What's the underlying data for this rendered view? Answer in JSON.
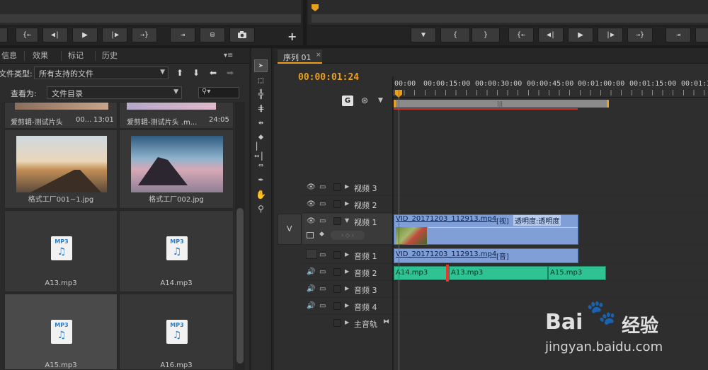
{
  "source_monitor": {
    "buttons": [
      "{←",
      "◀|",
      "▶",
      "|▶",
      "→}",
      "⇥",
      "⊟",
      "camera"
    ],
    "add": "+"
  },
  "program_monitor": {
    "buttons": [
      "▼",
      "{",
      "}",
      "{←",
      "◀|",
      "▶",
      "|▶",
      "→}",
      "⇥"
    ]
  },
  "project_panel": {
    "tabs": [
      "信息",
      "效果",
      "标记",
      "历史"
    ],
    "file_type_label": "文件类型:",
    "file_type_value": "所有支持的文件",
    "view_as_label": "查看为:",
    "view_as_value": "文件目录",
    "items": [
      {
        "name": "爱剪辑-测试片头",
        "extra": "00...",
        "duration": "13:01"
      },
      {
        "name": "爱剪辑-测试片头 .m...",
        "duration": "24:05"
      },
      {
        "name": "格式工厂001~1.jpg"
      },
      {
        "name": "格式工厂002.jpg"
      },
      {
        "name": "A13.mp3"
      },
      {
        "name": "A14.mp3"
      },
      {
        "name": "A15.mp3"
      },
      {
        "name": "A16.mp3"
      }
    ],
    "mp3_badge": "MP3"
  },
  "timeline": {
    "tab": "序列 01",
    "timecode": "00:00:01:24",
    "ruler": [
      "00:00",
      "00:00:15:00",
      "00:00:30:00",
      "00:00:45:00",
      "00:01:00:00",
      "00:01:15:00",
      "00:01:3"
    ],
    "track_target_v": "V",
    "tracks": [
      "视频 3",
      "视频 2",
      "视频 1",
      "音频 1",
      "音频 2",
      "音频 3",
      "音频 4",
      "主音轨"
    ],
    "video_clip": "VID_20171203_112913.mp4",
    "video_clip_tag": "[视]",
    "video_clip_fx": "透明度:透明度",
    "audio_clip": "VID_20171203_112913.mp4",
    "audio_clip_tag": "[音]",
    "a2_clips": [
      "A14.mp3",
      "A13.mp3",
      "A15.mp3"
    ]
  },
  "watermark": {
    "brand": "Bai",
    "brand2": "经验",
    "url": "jingyan.baidu.com"
  },
  "colors": {
    "accent_orange": "#e9a01e",
    "video_clip": "#7f9fd6",
    "audio_clip": "#2fc393",
    "playhead": "#e23b2e"
  }
}
